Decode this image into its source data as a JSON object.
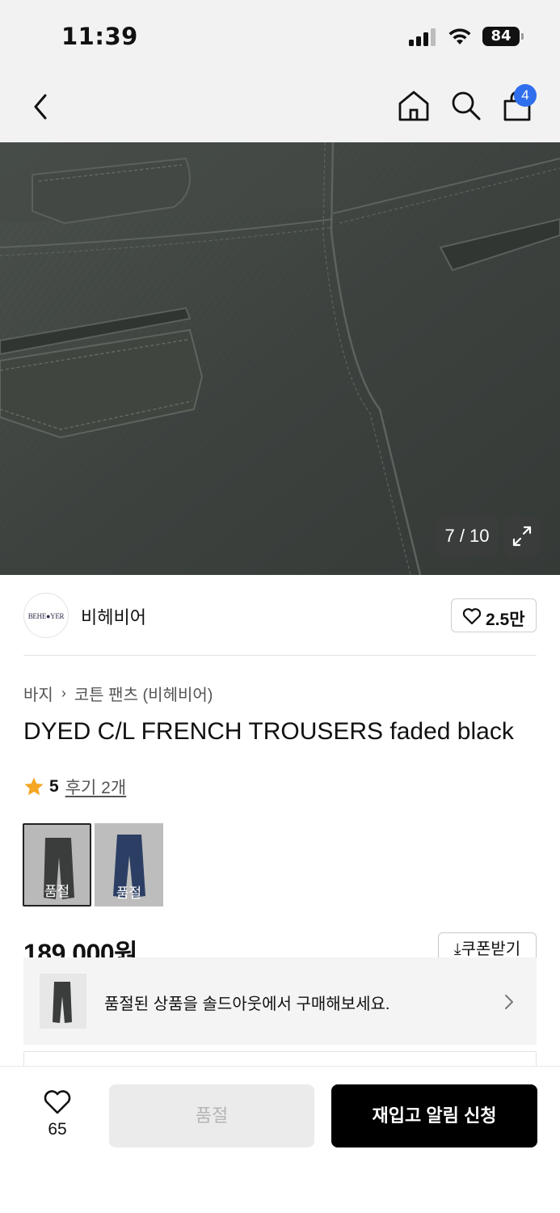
{
  "status_bar": {
    "time": "11:39",
    "battery": "84",
    "icons": [
      "cellular-signal-icon",
      "wifi-icon",
      "battery-icon"
    ]
  },
  "nav": {
    "icons": [
      "back-chevron-icon",
      "home-icon",
      "search-icon",
      "shopping-bag-icon"
    ],
    "cart_count": "4"
  },
  "gallery": {
    "counter": "7 / 10",
    "current_image": 7,
    "total_images": 10,
    "expand_icon": "expand-arrows-icon"
  },
  "brand": {
    "logo_text": "BEHE●YER",
    "name": "비헤비어",
    "likes": "2.5만"
  },
  "product": {
    "breadcrumb": [
      "바지",
      "코튼 팬츠 (비헤비어)"
    ],
    "title": "DYED C/L FRENCH TROUSERS faded black",
    "rating": "5",
    "reviews": "후기 2개",
    "price": "189,000원",
    "coupon": "쿠폰받기"
  },
  "swatches": [
    {
      "label": "품절",
      "color": "#3a3d3b",
      "selected": true
    },
    {
      "label": "품절",
      "color": "#2c3e63",
      "selected": false
    }
  ],
  "soldout_banner": {
    "text": "품절된 상품을 솔드아웃에서 구매해보세요."
  },
  "bottom_bar": {
    "favorite_count": "65",
    "soldout_label": "품절",
    "restock_label": "재입고 알림 신청"
  },
  "colors": {
    "accent_badge": "#2f6fed",
    "star": "#f5a623",
    "primary_button": "#000000",
    "disabled_button": "#ebebeb"
  }
}
